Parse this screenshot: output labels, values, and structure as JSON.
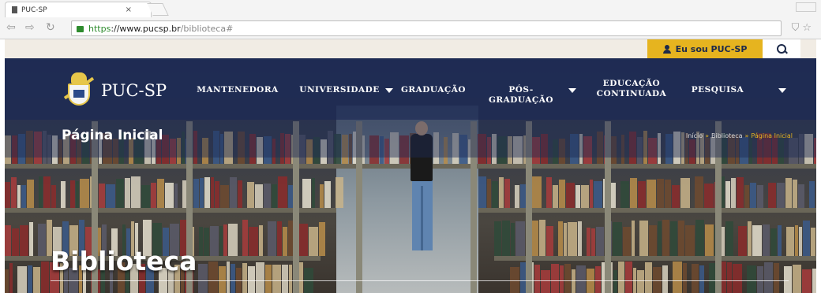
{
  "browser": {
    "tab_title": "PUC-SP",
    "tab_close": "×",
    "url_scheme": "https",
    "url_host": "://www.pucsp.br",
    "url_path": "/biblioteca#",
    "back_icon": "back-arrow-icon",
    "forward_icon": "forward-arrow-icon",
    "reload_icon": "reload-icon"
  },
  "utility": {
    "member_label": "Eu sou PUC-SP",
    "member_icon": "person-icon",
    "search_icon": "search-icon"
  },
  "logo": {
    "text": "PUC-SP"
  },
  "nav": {
    "items": [
      {
        "label": "MANTENEDORA"
      },
      {
        "label": "UNIVERSIDADE"
      },
      {
        "label": "GRADUAÇÃO"
      },
      {
        "label": "PÓS-GRADUAÇÃO"
      },
      {
        "label": "EDUCAÇÃO CONTINUADA"
      },
      {
        "label": "PESQUISA"
      }
    ]
  },
  "hero": {
    "page_heading": "Página Inicial",
    "breadcrumb": [
      "Início",
      "Biblioteca",
      "Página Inicial"
    ],
    "title": "Biblioteca"
  },
  "colors": {
    "navy": "#1c2a54",
    "gold": "#e6b41f"
  }
}
